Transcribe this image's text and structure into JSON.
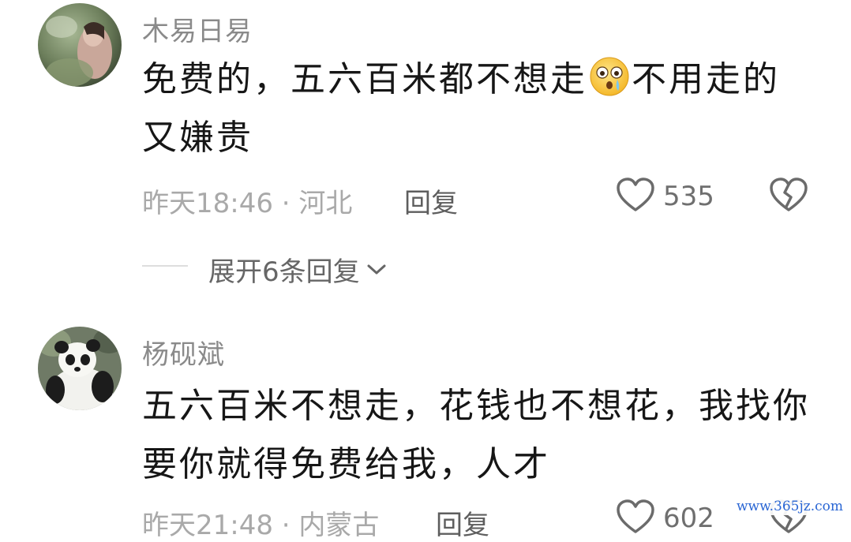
{
  "comments": [
    {
      "username": "木易日易",
      "text_part1": "免费的，五六百米都不想走",
      "emoji": "astonished-crying-icon",
      "text_part2": "不用走的又嫌贵",
      "time_location": "昨天18:46 · 河北",
      "reply_label": "回复",
      "like_count": "535",
      "expand_replies": "展开6条回复"
    },
    {
      "username": "杨砚斌",
      "text": "五六百米不想走，花钱也不想花，我找你要你就得免费给我，人才",
      "time_location": "昨天21:48 · 内蒙古",
      "reply_label": "回复",
      "like_count": "602"
    }
  ],
  "watermark": "www.365jz.com",
  "colors": {
    "username": "#8a8a8a",
    "meta": "#a9a9a9",
    "text": "#161616",
    "watermark": "#2a66d4"
  }
}
